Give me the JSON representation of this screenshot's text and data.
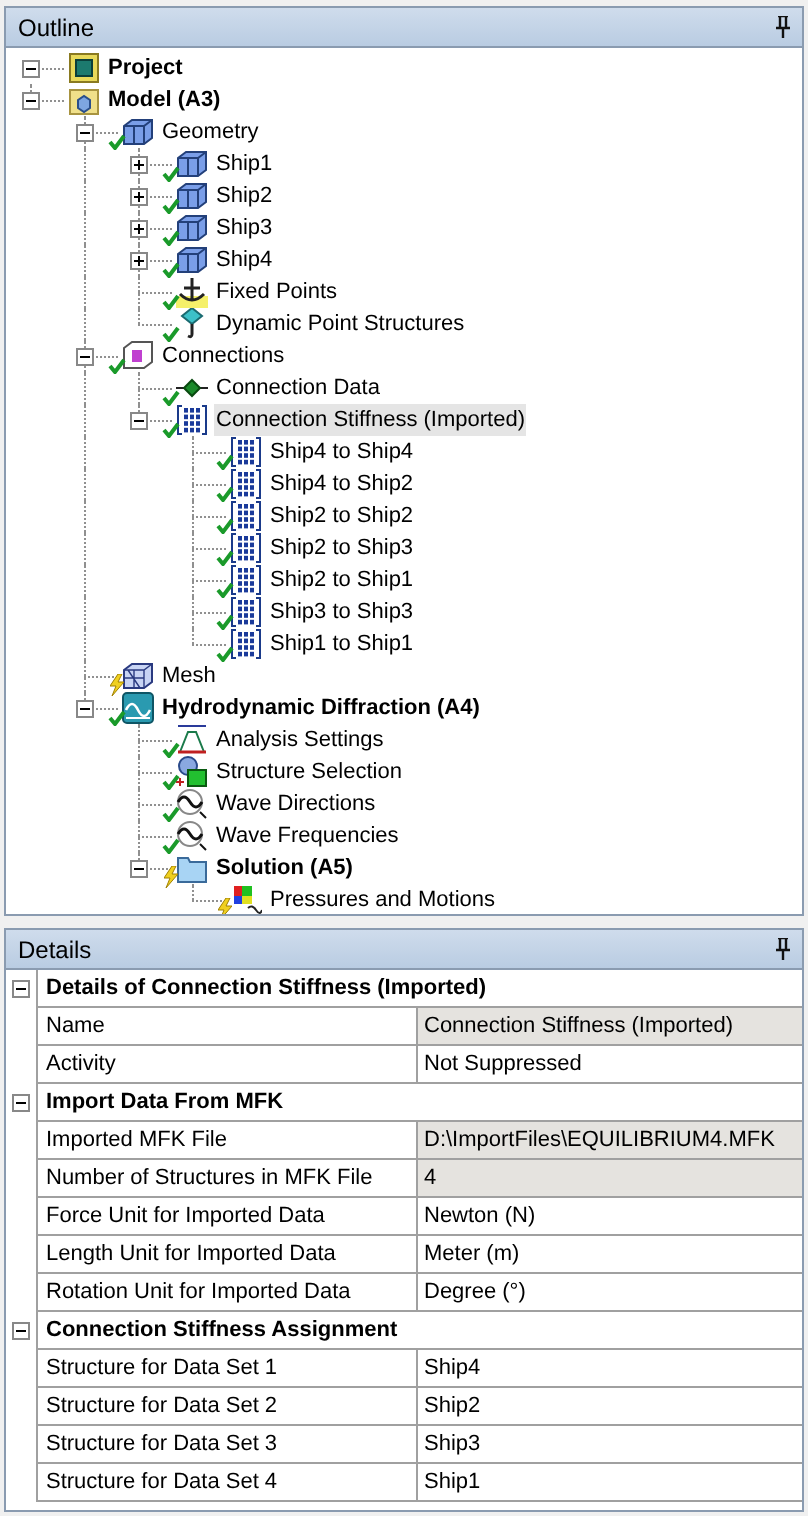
{
  "outline": {
    "title": "Outline",
    "tree": [
      {
        "label": "Project",
        "bold": true,
        "kind": "project",
        "expanded": true,
        "selected": false,
        "children": [
          {
            "label": "Model (A3)",
            "bold": true,
            "kind": "model",
            "expanded": true,
            "selected": false,
            "children": [
              {
                "label": "Geometry",
                "bold": false,
                "kind": "body",
                "solved": true,
                "expanded": true,
                "selected": false,
                "children": [
                  {
                    "label": "Ship1",
                    "bold": false,
                    "kind": "body",
                    "solved": true,
                    "expanded": false,
                    "selected": false
                  },
                  {
                    "label": "Ship2",
                    "bold": false,
                    "kind": "body",
                    "solved": true,
                    "expanded": false,
                    "selected": false
                  },
                  {
                    "label": "Ship3",
                    "bold": false,
                    "kind": "body",
                    "solved": true,
                    "expanded": false,
                    "selected": false
                  },
                  {
                    "label": "Ship4",
                    "bold": false,
                    "kind": "body",
                    "solved": true,
                    "expanded": false,
                    "selected": false
                  },
                  {
                    "label": "Fixed Points",
                    "bold": false,
                    "kind": "anchor",
                    "solved": true,
                    "selected": false
                  },
                  {
                    "label": "Dynamic Point Structures",
                    "bold": false,
                    "kind": "point",
                    "solved": true,
                    "selected": false
                  }
                ]
              },
              {
                "label": "Connections",
                "bold": false,
                "kind": "connections",
                "solved": true,
                "expanded": true,
                "selected": false,
                "children": [
                  {
                    "label": "Connection Data",
                    "bold": false,
                    "kind": "link",
                    "solved": true,
                    "selected": false
                  },
                  {
                    "label": "Connection Stiffness (Imported)",
                    "bold": false,
                    "kind": "matrix",
                    "solved": true,
                    "expanded": true,
                    "selected": true,
                    "children": [
                      {
                        "label": "Ship4 to Ship4",
                        "bold": false,
                        "kind": "matrix",
                        "solved": true,
                        "selected": false
                      },
                      {
                        "label": "Ship4 to Ship2",
                        "bold": false,
                        "kind": "matrix",
                        "solved": true,
                        "selected": false
                      },
                      {
                        "label": "Ship2 to Ship2",
                        "bold": false,
                        "kind": "matrix",
                        "solved": true,
                        "selected": false
                      },
                      {
                        "label": "Ship2 to Ship3",
                        "bold": false,
                        "kind": "matrix",
                        "solved": true,
                        "selected": false
                      },
                      {
                        "label": "Ship2 to Ship1",
                        "bold": false,
                        "kind": "matrix",
                        "solved": true,
                        "selected": false
                      },
                      {
                        "label": "Ship3 to Ship3",
                        "bold": false,
                        "kind": "matrix",
                        "solved": true,
                        "selected": false
                      },
                      {
                        "label": "Ship1 to Ship1",
                        "bold": false,
                        "kind": "matrix",
                        "solved": true,
                        "selected": false
                      }
                    ]
                  }
                ]
              },
              {
                "label": "Mesh",
                "bold": false,
                "kind": "mesh",
                "solved": false,
                "selected": false
              },
              {
                "label": "Hydrodynamic Diffraction (A4)",
                "bold": true,
                "kind": "hydro",
                "solved": true,
                "expanded": true,
                "selected": false,
                "children": [
                  {
                    "label": "Analysis Settings",
                    "bold": false,
                    "kind": "analysis",
                    "solved": true,
                    "selected": false
                  },
                  {
                    "label": "Structure Selection",
                    "bold": false,
                    "kind": "structures",
                    "solved": true,
                    "selected": false
                  },
                  {
                    "label": "Wave Directions",
                    "bold": false,
                    "kind": "wave",
                    "solved": true,
                    "selected": false
                  },
                  {
                    "label": "Wave Frequencies",
                    "bold": false,
                    "kind": "wave",
                    "solved": true,
                    "selected": false
                  },
                  {
                    "label": "Solution (A5)",
                    "bold": true,
                    "kind": "solution",
                    "solved": false,
                    "expanded": true,
                    "selected": false,
                    "children": [
                      {
                        "label": "Pressures and Motions",
                        "bold": false,
                        "kind": "results",
                        "solved": false,
                        "selected": false
                      }
                    ]
                  }
                ]
              }
            ]
          }
        ]
      }
    ]
  },
  "details": {
    "title": "Details",
    "groups": [
      {
        "title": "Details of Connection Stiffness (Imported)",
        "expanded": true,
        "properties": [
          {
            "name": "Name",
            "value": "Connection Stiffness (Imported)",
            "readonly": true
          },
          {
            "name": "Activity",
            "value": "Not Suppressed",
            "readonly": false
          }
        ]
      },
      {
        "title": "Import Data From MFK",
        "expanded": true,
        "properties": [
          {
            "name": "Imported MFK File",
            "value": "D:\\ImportFiles\\EQUILIBRIUM4.MFK",
            "readonly": true
          },
          {
            "name": "Number of Structures in MFK File",
            "value": "4",
            "readonly": true
          },
          {
            "name": "Force Unit for Imported Data",
            "value": "Newton (N)",
            "readonly": false
          },
          {
            "name": "Length Unit for Imported Data",
            "value": "Meter (m)",
            "readonly": false
          },
          {
            "name": "Rotation Unit for Imported Data",
            "value": "Degree (°)",
            "readonly": false
          }
        ]
      },
      {
        "title": "Connection Stiffness Assignment",
        "expanded": true,
        "properties": [
          {
            "name": "Structure for Data Set 1",
            "value": "Ship4",
            "readonly": false
          },
          {
            "name": "Structure for Data Set 2",
            "value": "Ship2",
            "readonly": false
          },
          {
            "name": "Structure for Data Set 3",
            "value": "Ship3",
            "readonly": false
          },
          {
            "name": "Structure for Data Set 4",
            "value": "Ship1",
            "readonly": false
          }
        ]
      }
    ]
  }
}
